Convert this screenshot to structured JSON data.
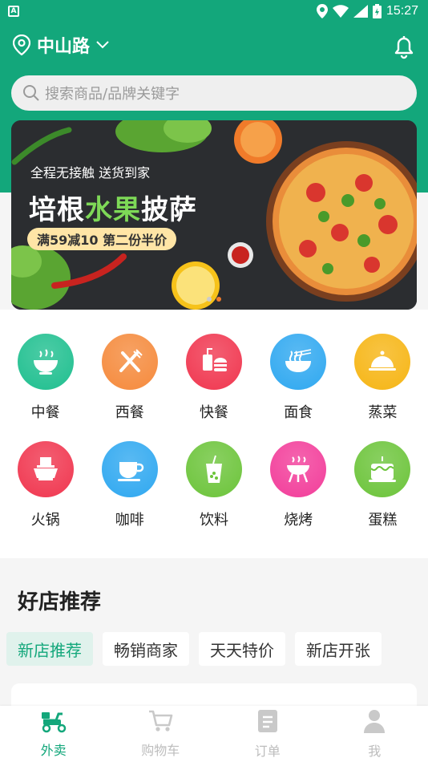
{
  "status_bar": {
    "time": "15:27",
    "app_letter": "A"
  },
  "header": {
    "location": "中山路"
  },
  "search": {
    "placeholder": "搜索商品/品牌关键字"
  },
  "banner": {
    "line1": "全程无接触 送货到家",
    "title_part1": "培根",
    "title_highlight": "水果",
    "title_part2": "披萨",
    "promo": "满59减10 第二份半价"
  },
  "categories": [
    {
      "label": "中餐",
      "icon": "bowl-icon",
      "color": "#1fbf8f"
    },
    {
      "label": "西餐",
      "icon": "fork-knife-icon",
      "color": "#f58a3c"
    },
    {
      "label": "快餐",
      "icon": "burger-drink-icon",
      "color": "#f0364f"
    },
    {
      "label": "面食",
      "icon": "noodle-bowl-icon",
      "color": "#2fa8f0"
    },
    {
      "label": "蒸菜",
      "icon": "cloche-icon",
      "color": "#f6b514"
    },
    {
      "label": "火锅",
      "icon": "hotpot-icon",
      "color": "#f0364f"
    },
    {
      "label": "咖啡",
      "icon": "coffee-cup-icon",
      "color": "#2fa8f0"
    },
    {
      "label": "饮料",
      "icon": "drink-cup-icon",
      "color": "#6cc43a"
    },
    {
      "label": "烧烤",
      "icon": "grill-icon",
      "color": "#f23d9a"
    },
    {
      "label": "蛋糕",
      "icon": "cake-icon",
      "color": "#6cc43a"
    }
  ],
  "recommend": {
    "title": "好店推荐",
    "tabs": [
      "新店推荐",
      "畅销商家",
      "天天特价",
      "新店开张"
    ]
  },
  "bottom_nav": [
    {
      "label": "外卖",
      "icon": "scooter-icon"
    },
    {
      "label": "购物车",
      "icon": "cart-icon"
    },
    {
      "label": "订单",
      "icon": "order-icon"
    },
    {
      "label": "我",
      "icon": "user-icon"
    }
  ],
  "colors": {
    "primary": "#13a77b",
    "search_bg": "#efefef"
  }
}
